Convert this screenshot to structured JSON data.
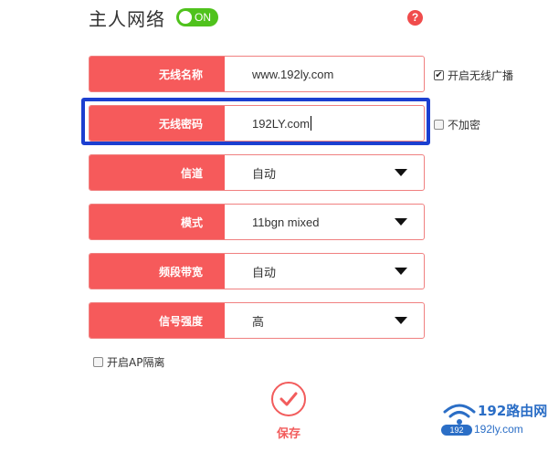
{
  "header": {
    "title": "主人网络",
    "toggle_label": "ON"
  },
  "help": {
    "symbol": "?"
  },
  "rows": [
    {
      "label": "无线名称",
      "value": "www.192ly.com"
    },
    {
      "label": "无线密码",
      "value": "192LY.com"
    },
    {
      "label": "信道",
      "value": "自动"
    },
    {
      "label": "模式",
      "value": "11bgn mixed"
    },
    {
      "label": "频段带宽",
      "value": "自动"
    },
    {
      "label": "信号强度",
      "value": "高"
    }
  ],
  "side_options": {
    "broadcast": {
      "label": "开启无线广播",
      "checked": true
    },
    "no_encrypt": {
      "label": "不加密",
      "checked": false
    }
  },
  "ap_isolation": {
    "label": "开启AP隔离",
    "checked": false
  },
  "save": {
    "label": "保存"
  },
  "watermark": {
    "title": "192路由网",
    "url": "192ly.com"
  },
  "colors": {
    "accent": "#f65a5b",
    "toggle_on": "#4fc21c",
    "highlight": "#1c3fd0",
    "watermark": "#2b6ec6"
  }
}
